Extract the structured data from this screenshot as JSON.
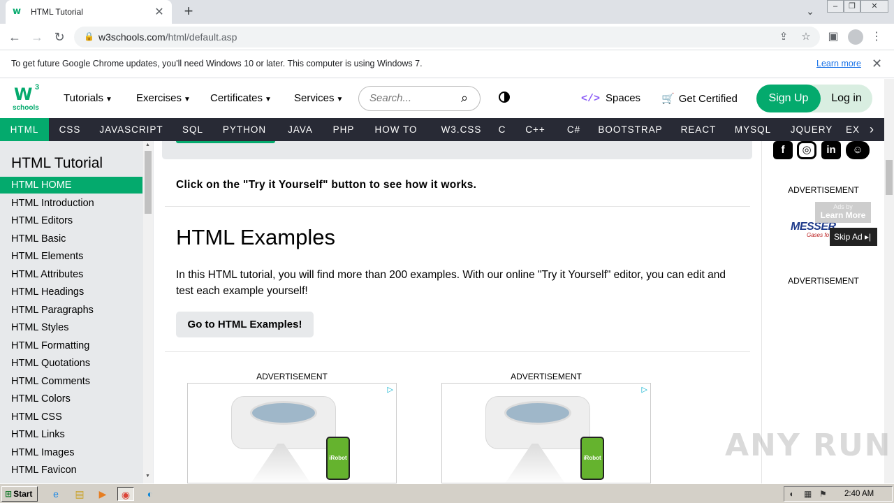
{
  "browser": {
    "tab_title": "HTML Tutorial",
    "tab_favicon": "w3schools-favicon-icon",
    "url_host": "w3schools.com",
    "url_path": "/html/default.asp",
    "infobar_text": "To get future Google Chrome updates, you'll need Windows 10 or later. This computer is using Windows 7.",
    "infobar_link": "Learn more"
  },
  "header": {
    "logo_main": "W",
    "logo_sup": "3",
    "logo_sub": "schools",
    "menus": [
      "Tutorials",
      "Exercises",
      "Certificates",
      "Services"
    ],
    "search_placeholder": "Search...",
    "spaces": "Spaces",
    "certified": "Get Certified",
    "signup": "Sign Up",
    "login": "Log in"
  },
  "topnav": {
    "items": [
      "HTML",
      "CSS",
      "JAVASCRIPT",
      "SQL",
      "PYTHON",
      "JAVA",
      "PHP",
      "HOW TO",
      "W3.CSS",
      "C",
      "C++",
      "C#",
      "BOOTSTRAP",
      "REACT",
      "MYSQL",
      "JQUERY",
      "EX"
    ],
    "active": "HTML"
  },
  "sidebar": {
    "title": "HTML Tutorial",
    "items": [
      "HTML HOME",
      "HTML Introduction",
      "HTML Editors",
      "HTML Basic",
      "HTML Elements",
      "HTML Attributes",
      "HTML Headings",
      "HTML Paragraphs",
      "HTML Styles",
      "HTML Formatting",
      "HTML Quotations",
      "HTML Comments",
      "HTML Colors",
      "HTML CSS",
      "HTML Links",
      "HTML Images",
      "HTML Favicon"
    ],
    "active": "HTML HOME"
  },
  "main": {
    "try_text": "Click on the \"Try it Yourself\" button to see how it works.",
    "heading": "HTML Examples",
    "paragraph": "In this HTML tutorial, you will find more than 200 examples. With our online \"Try it Yourself\" editor, you can edit and test each example yourself!",
    "go_button": "Go to HTML Examples!",
    "ad_label": "ADVERTISEMENT",
    "ad_product_text": "iRobot"
  },
  "right": {
    "ad_label": "ADVERTISEMENT",
    "ads_by": "Ads by",
    "learn_more": "Learn More",
    "brand": "MESSER",
    "brand_sub": "Gases fo",
    "skip_ad": "Skip Ad ▸|"
  },
  "watermark": "ANY RUN",
  "taskbar": {
    "start": "Start",
    "clock": "2:40 AM"
  },
  "colors": {
    "brand_green": "#04aa6d",
    "nav_dark": "#282a35",
    "sidebar_bg": "#e7e9eb"
  }
}
